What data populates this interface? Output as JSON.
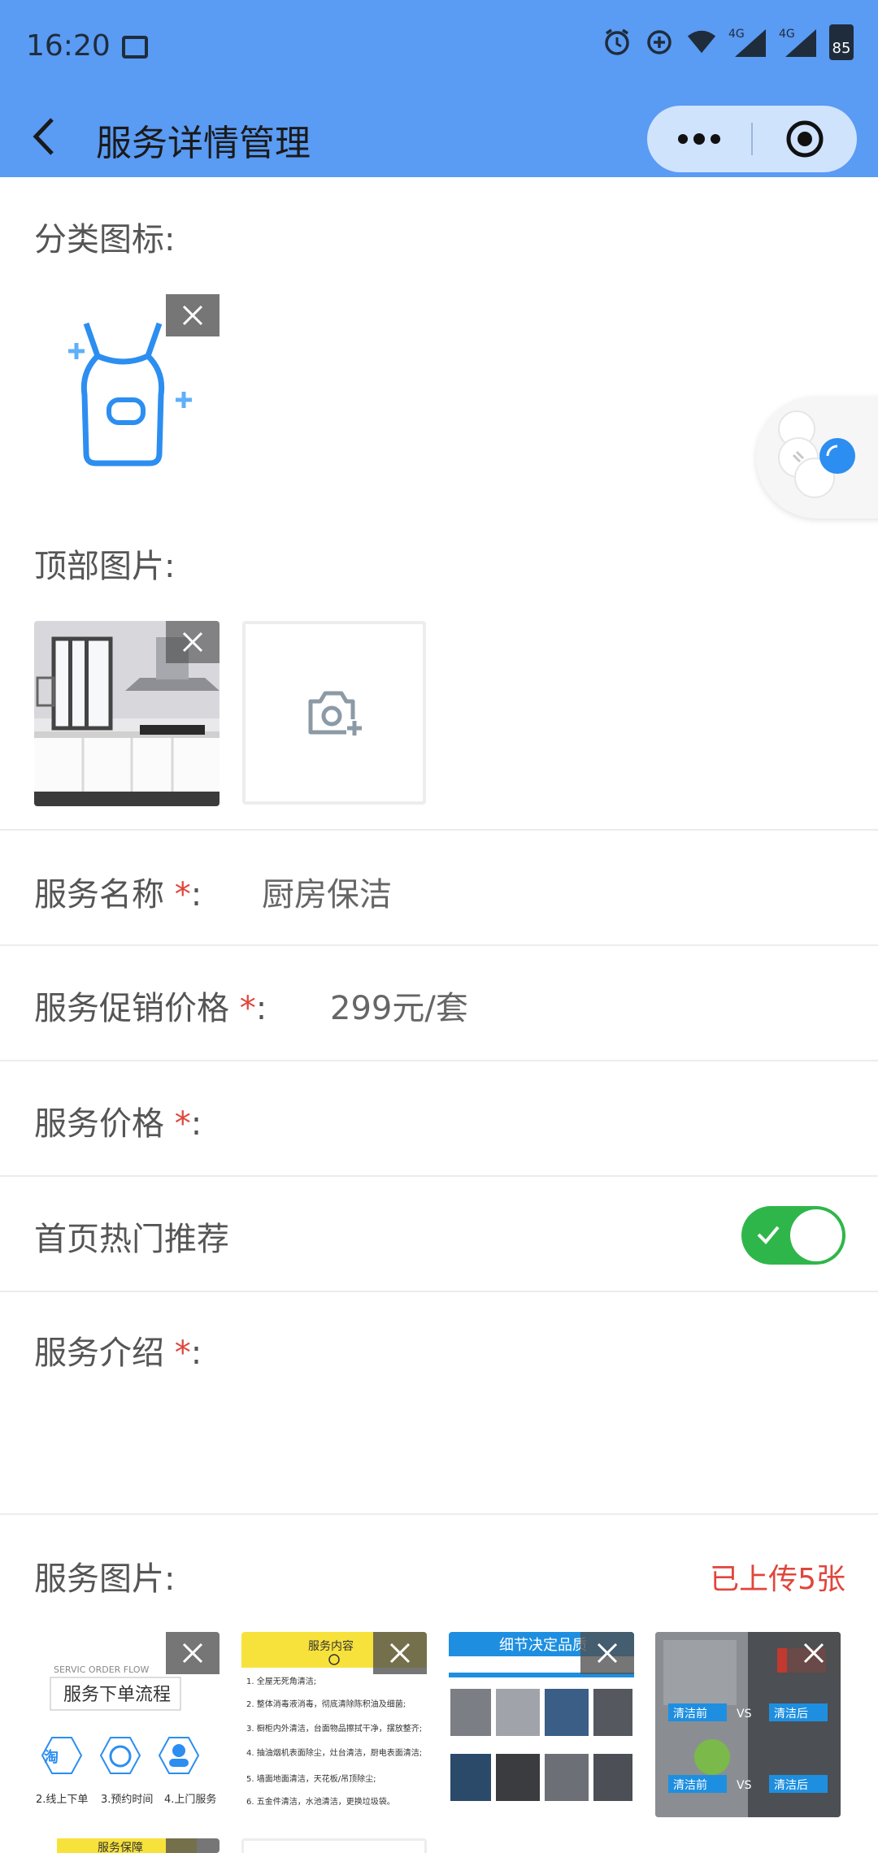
{
  "status_bar": {
    "time": "16:20",
    "battery": "85",
    "network_1": "4G",
    "network_2": "4G"
  },
  "nav": {
    "title": "服务详情管理"
  },
  "category_icon": {
    "label": "分类图标:"
  },
  "top_image": {
    "label": "顶部图片:"
  },
  "form": {
    "service_name": {
      "label": "服务名称",
      "required_mark": "*",
      "colon": ":",
      "value": "厨房保洁"
    },
    "promo_price": {
      "label": "服务促销价格",
      "required_mark": "*",
      "colon": ":",
      "value": "299元/套"
    },
    "price": {
      "label": "服务价格",
      "required_mark": "*",
      "colon": ":",
      "value": ""
    },
    "hot_recommend": {
      "label": "首页热门推荐",
      "enabled": true
    },
    "intro": {
      "label": "服务介绍",
      "required_mark": "*",
      "colon": ":"
    }
  },
  "service_images": {
    "label": "服务图片:",
    "count_label": "已上传5张",
    "thumbs": [
      {
        "title": "服务下单流程",
        "subtitle": "SERVIC ORDER FLOW",
        "steps": [
          "2.线上下单",
          "3.预约时间",
          "4.上门服务"
        ]
      },
      {
        "title": "服务内容",
        "items": [
          "1. 全屋无死角清洁;",
          "2. 整体消毒液消毒，彻底清除陈积油及细菌;",
          "3. 橱柜内外清洁，台面物品擦拭干净，摆放整齐;",
          "4. 抽油烟机表面除尘，灶台清洁，厨电表面清洁;",
          "5. 墙面地面清洁，天花板/吊顶除尘;",
          "6. 五金件清洁，水池清洁，更换垃圾袋。"
        ]
      },
      {
        "title": "细节决定品质"
      },
      {
        "before": "清洁前",
        "vs": "VS",
        "after": "清洁后"
      }
    ],
    "row2": [
      {
        "title": "服务保障"
      }
    ]
  }
}
